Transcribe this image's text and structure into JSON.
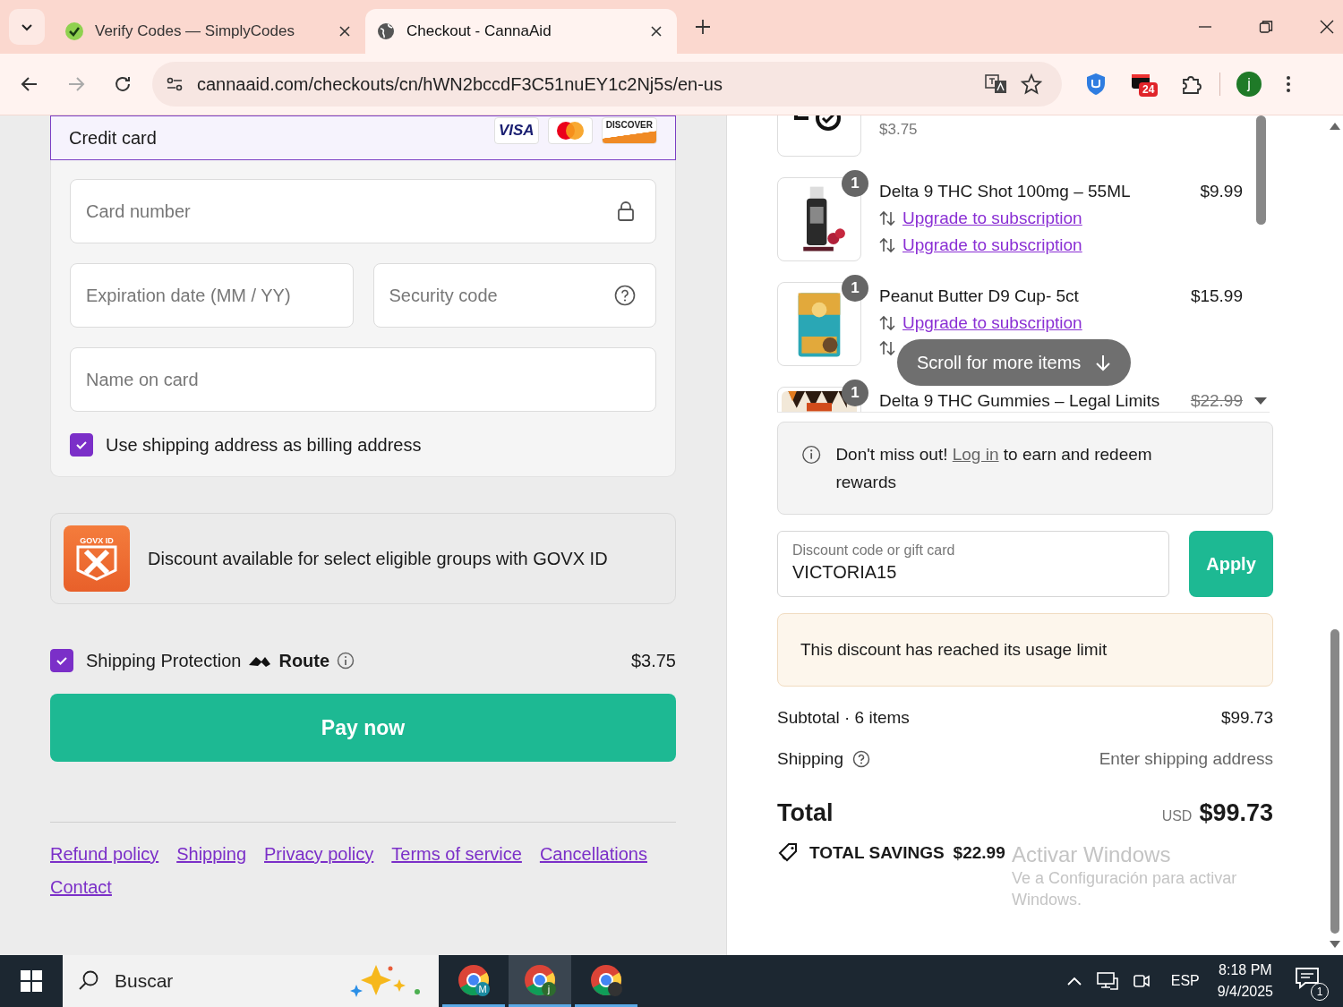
{
  "browser": {
    "tabs": [
      {
        "title": "Verify Codes — SimplyCodes",
        "selected": false,
        "kind": "simplycodes"
      },
      {
        "title": "Checkout - CannaAid",
        "selected": true,
        "kind": "globe"
      }
    ],
    "nav_buttons": [
      {
        "kind": "back",
        "disabled": false
      },
      {
        "kind": "forward",
        "disabled": true
      },
      {
        "kind": "reload",
        "disabled": false
      }
    ],
    "url": "cannaaid.com/checkouts/cn/hWN2bccdF3C51nuEY1c2Nj5s/en-us",
    "extension_badge": "24",
    "profile_initial": "j"
  },
  "payment": {
    "method": "Credit card",
    "brands": [
      {
        "kind": "visa",
        "text": "VISA"
      },
      {
        "kind": "mastercard"
      },
      {
        "kind": "discover",
        "text": "DISCOVER"
      }
    ],
    "fields": [
      {
        "placeholder": "Card number",
        "kind": "number"
      },
      {
        "placeholder": "Expiration date (MM / YY)",
        "kind": "expiry"
      },
      {
        "placeholder": "Security code",
        "kind": "cvc"
      },
      {
        "placeholder": "Name on card",
        "kind": "name"
      }
    ],
    "billing": {
      "label": "Use shipping address as billing address",
      "checked": true
    }
  },
  "govx": {
    "logo_text": "GOVX ID",
    "text": "Discount available for select eligible groups with GOVX ID"
  },
  "shipping_protection": {
    "checked": true,
    "label": "Shipping Protection",
    "brand": "Route",
    "price": "$3.75"
  },
  "pay_button": "Pay now",
  "footer_links": [
    "Refund policy",
    "Shipping",
    "Privacy policy",
    "Terms of service",
    "Cancellations",
    "Contact"
  ],
  "cart": {
    "items": [
      {
        "kind": "protection",
        "price": "$3.75"
      },
      {
        "kind": "bottle",
        "quantity": "1",
        "name": "Delta 9 THC Shot 100mg – 55ML",
        "price": "$9.99",
        "links": [
          "Upgrade to subscription",
          "Upgrade to subscription"
        ]
      },
      {
        "kind": "pouch",
        "quantity": "1",
        "name": "Peanut Butter D9 Cup- 5ct",
        "price": "$15.99",
        "links": [
          "Upgrade to subscription"
        ]
      },
      {
        "kind": "gummies",
        "quantity": "1",
        "name": "Delta 9 THC Gummies – Legal Limits",
        "price": "$22.99",
        "struck": true
      }
    ],
    "scroll_hint": "Scroll for more items"
  },
  "rewards": {
    "before": "Don't miss out!",
    "link": "Log in",
    "after": "to earn and redeem rewards"
  },
  "discount": {
    "label": "Discount code or gift card",
    "value": "VICTORIA15",
    "button": "Apply",
    "error": "This discount has reached its usage limit"
  },
  "summary": [
    {
      "label": "Subtotal · 6 items",
      "value": "$99.73",
      "kind": "plain"
    },
    {
      "label": "Shipping",
      "value": "Enter shipping address",
      "kind": "hint"
    }
  ],
  "total": {
    "label": "Total",
    "currency": "USD",
    "amount": "$99.73",
    "savings_label": "TOTAL SAVINGS",
    "savings": "$22.99"
  },
  "windows_notice": {
    "title": "Activar Windows",
    "text": "Ve a Configuración para activar Windows."
  },
  "taskbar": {
    "search": "Buscar",
    "apps": [
      {
        "badge": "M",
        "selected": false
      },
      {
        "badge": "j",
        "selected": true
      },
      {
        "selected": false
      }
    ],
    "language": "ESP",
    "time": "8:18 PM",
    "date": "9/4/2025",
    "notifications": "1"
  }
}
